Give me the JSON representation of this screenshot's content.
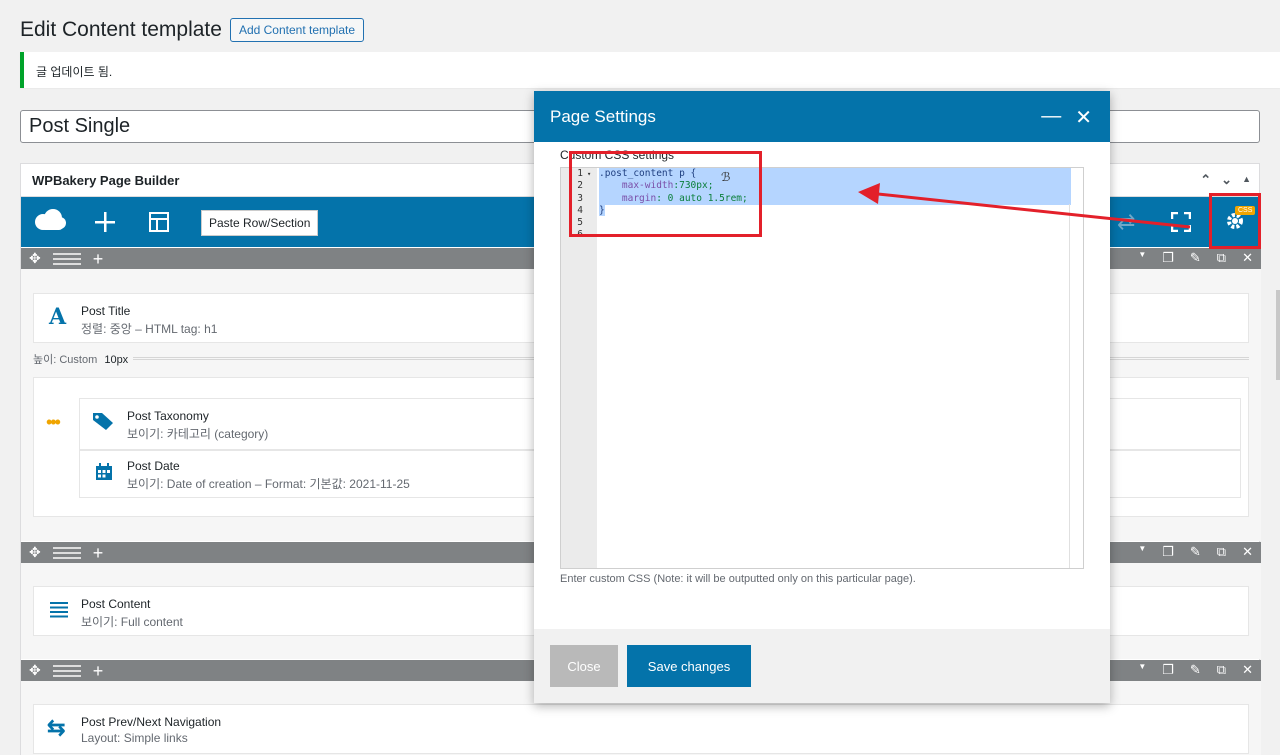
{
  "header": {
    "title": "Edit Content template",
    "add_button": "Add Content template"
  },
  "notice": {
    "text": "글 업데이트 됨."
  },
  "post_title": {
    "value": "Post Single"
  },
  "builder": {
    "title": "WPBakery Page Builder",
    "paste_button": "Paste Row/Section",
    "elements": {
      "post_title": {
        "title": "Post Title",
        "sub": "정렬: 중앙  – HTML tag: h1"
      },
      "spacer": {
        "label": "높이: Custom",
        "value": "10px"
      },
      "post_taxonomy": {
        "title": "Post Taxonomy",
        "sub": "보이기: 카테고리 (category)"
      },
      "post_date": {
        "title": "Post Date",
        "sub": "보이기: Date of creation  – Format: 기본값: 2021-11-25"
      },
      "post_content": {
        "title": "Post Content",
        "sub": "보이기: Full content"
      },
      "post_nav": {
        "title": "Post Prev/Next Navigation",
        "sub": "Layout: Simple links"
      }
    },
    "css_badge": "CSS"
  },
  "modal": {
    "title": "Page Settings",
    "section_label": "Custom CSS settings",
    "line_numbers": [
      "1",
      "2",
      "3",
      "4",
      "5",
      "6"
    ],
    "code": {
      "l1_sel": ".post_content p {",
      "l2_prop": "max-width",
      "l2_val": ":730px;",
      "l3_prop": "margin",
      "l3_val": ": 0 auto 1.5rem;",
      "l4": "}"
    },
    "hint": "Enter custom CSS (Note: it will be outputted only on this particular page).",
    "close_button": "Close",
    "save_button": "Save changes"
  },
  "colors": {
    "accent": "#0473aa",
    "annotation": "#e3202a",
    "success": "#00a32a"
  }
}
